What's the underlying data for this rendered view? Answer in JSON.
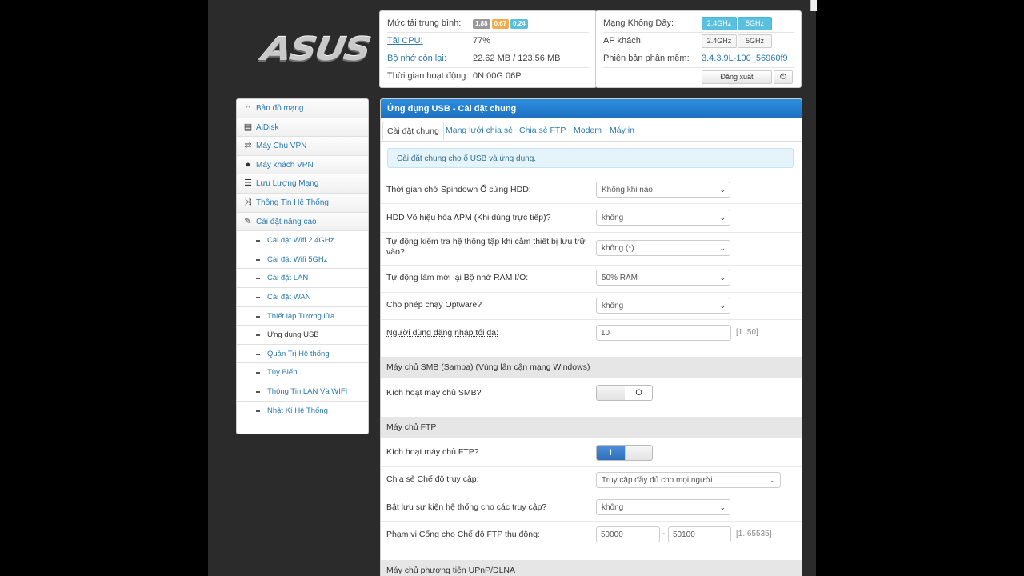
{
  "header": {
    "logo_text": "ASUS"
  },
  "status": {
    "load_label": "Mức tải trung bình:",
    "load_values": [
      "1.88",
      "0.67",
      "0.24"
    ],
    "load_colors": [
      "#999999",
      "#f0ad4e",
      "#5bc0de"
    ],
    "cpu_label": "Tải CPU:",
    "cpu_value": "77%",
    "mem_label": "Bộ nhớ còn lại:",
    "mem_value": "22.62 MB / 123.56 MB",
    "uptime_label": "Thời gian hoạt động:",
    "uptime_value": "0N 00G 06P"
  },
  "wifi": {
    "wireless_label": "Mạng Không Dây:",
    "wireless_24": "2.4GHz",
    "wireless_5": "5GHz",
    "ap_label": "AP khách:",
    "ap_24": "2.4GHz",
    "ap_5": "5GHz",
    "fw_label": "Phiên bản phần mềm:",
    "fw_value": "3.4.3.9L-100_56960f9",
    "logout_label": "Đăng xuất",
    "power_icon": "power-icon"
  },
  "sidebar": {
    "items": [
      {
        "label": "Bản đồ mạng",
        "icon": "home-icon"
      },
      {
        "label": "AiDisk",
        "icon": "disk-icon"
      },
      {
        "label": "Máy Chủ VPN",
        "icon": "retweet-icon"
      },
      {
        "label": "Máy khách VPN",
        "icon": "globe-icon"
      },
      {
        "label": "Lưu Lượng Mạng",
        "icon": "list-icon"
      },
      {
        "label": "Thông Tin Hệ Thống",
        "icon": "shuffle-icon"
      },
      {
        "label": "Cài đặt nâng cao",
        "icon": "wrench-icon"
      }
    ],
    "subitems": [
      "Cài đặt Wifi 2.4GHz",
      "Cài đặt Wifi 5GHz",
      "Cài đặt LAN",
      "Cài đặt WAN",
      "Thiết lập Tường lửa",
      "Ứng dụng USB",
      "Quản Trị Hệ thống",
      "Tùy Biến",
      "Thông Tin LAN Và WIFI",
      "Nhật Kí Hệ Thống"
    ],
    "active_subitem": "Ứng dụng USB"
  },
  "main": {
    "title": "Ứng dụng USB - Cài đặt chung",
    "tabs": [
      "Cài đặt chung",
      "Mạng lưới chia sẻ",
      "Chia sẻ FTP",
      "Modem",
      "Máy in"
    ],
    "active_tab": "Cài đặt chung",
    "info": "Cài đặt chung cho ổ USB và ứng dụng.",
    "fields": {
      "spindown_label": "Thời gian chờ Spindown Ổ cứng HDD:",
      "spindown_value": "Không khi nào",
      "apm_label": "HDD Vô hiệu hóa APM (Khi dùng trực tiếp)?",
      "apm_value": "không",
      "fscheck_label": "Tự động kiểm tra hệ thống tập khi cắm thiết bị lưu trữ vào?",
      "fscheck_value": "không (*)",
      "ram_label": "Tự động làm mới lại Bộ nhớ RAM I/O:",
      "ram_value": "50% RAM",
      "optware_label": "Cho phép chạy Optware?",
      "optware_value": "không",
      "maxusers_label": "Người dùng đăng nhập tối đa:",
      "maxusers_value": "10",
      "maxusers_hint": "[1..50]"
    },
    "smb": {
      "section_title": "Máy chủ SMB (Samba) (Vùng lân cận mạng Windows)",
      "enable_label": "Kích hoạt máy chủ SMB?",
      "toggle_glyph": "O"
    },
    "ftp": {
      "section_title": "Máy chủ FTP",
      "enable_label": "Kích hoạt máy chủ FTP?",
      "toggle_glyph": "I",
      "access_label": "Chia sẻ Chế độ truy cập:",
      "access_value": "Truy cập đầy đủ cho mọi người",
      "log_label": "Bật lưu sự kiện hệ thống cho các truy cập?",
      "log_value": "không",
      "passive_label": "Phạm vi Cổng cho Chế độ FTP thụ động:",
      "passive_from": "50000",
      "passive_sep": "-",
      "passive_to": "50100",
      "passive_hint": "[1..65535]"
    },
    "upnp": {
      "section_title": "Máy chủ phương tiện UPnP/DLNA"
    }
  }
}
